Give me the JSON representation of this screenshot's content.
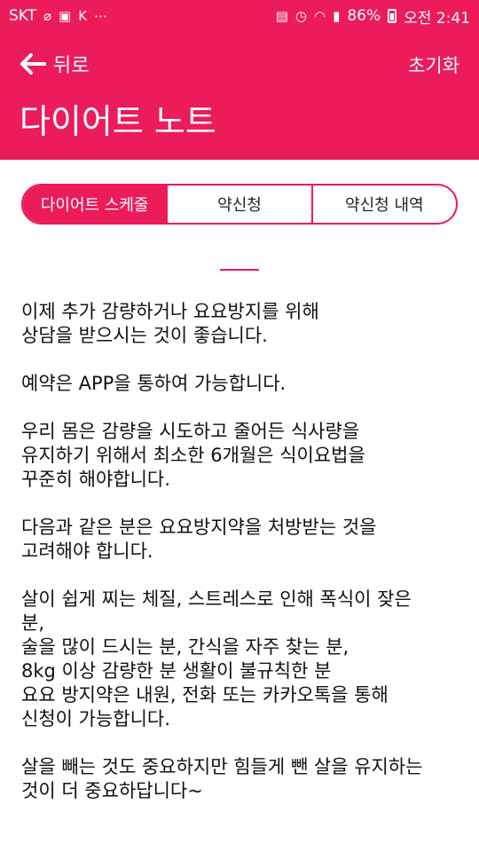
{
  "status_bar": {
    "carrier": "SKT",
    "battery": "86%",
    "time": "오전 2:41"
  },
  "header": {
    "back_label": "뒤로",
    "reset_label": "초기화",
    "title": "다이어트 노트"
  },
  "tabs": [
    {
      "label": "다이어트 스케줄",
      "active": true
    },
    {
      "label": "약신청",
      "active": false
    },
    {
      "label": "약신청 내역",
      "active": false
    }
  ],
  "content": {
    "paragraphs": [
      [
        "이제 추가 감량하거나 요요방지를 위해",
        "상담을 받으시는 것이 좋습니다."
      ],
      [
        "예약은 APP을 통하여 가능합니다."
      ],
      [
        "우리 몸은 감량을 시도하고 줄어든 식사량을",
        "유지하기 위해서 최소한 6개월은 식이요법을",
        "꾸준히 해야합니다."
      ],
      [
        "다음과 같은 분은 요요방지약을 처방받는 것을",
        "고려해야 합니다."
      ],
      [
        "살이 쉽게 찌는 체질, 스트레스로 인해 폭식이 잦은",
        "분,",
        "술을 많이 드시는 분, 간식을 자주 찾는 분,",
        "8kg 이상 감량한 분 생활이 불규칙한 분",
        "요요 방지약은 내원, 전화 또는 카카오톡을 통해",
        "신청이 가능합니다."
      ],
      [
        "살을 빼는 것도 중요하지만 힘들게 뺀 살을 유지하는",
        "것이 더 중요하답니다~"
      ]
    ]
  },
  "colors": {
    "accent": "#ec1b5a",
    "text": "#111111",
    "background": "#ffffff"
  }
}
